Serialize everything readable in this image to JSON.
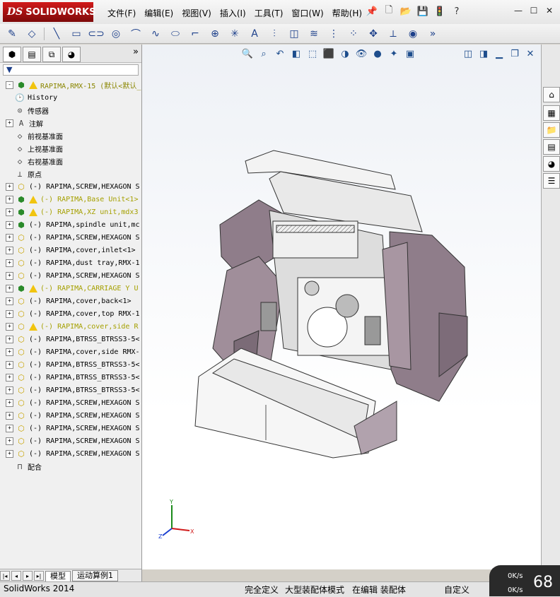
{
  "app": {
    "logo_ds": "DS",
    "logo_text": "SOLIDWORKS"
  },
  "menu": [
    {
      "label": "文件(F)"
    },
    {
      "label": "编辑(E)"
    },
    {
      "label": "视图(V)"
    },
    {
      "label": "插入(I)"
    },
    {
      "label": "工具(T)"
    },
    {
      "label": "窗口(W)"
    },
    {
      "label": "帮助(H)"
    }
  ],
  "panel_tabs": [
    "feature-manager",
    "property-manager",
    "configuration-manager",
    "display-manager"
  ],
  "tree": {
    "root": "RAPIMA,RMX-15  (默认<默认_",
    "items": [
      {
        "label": "History",
        "icon": "history-icon",
        "expand": false,
        "warn": false
      },
      {
        "label": "传感器",
        "icon": "sensor-icon",
        "expand": false,
        "warn": false
      },
      {
        "label": "注解",
        "icon": "annotation-icon",
        "expand": true,
        "warn": false
      },
      {
        "label": "前视基准面",
        "icon": "plane-icon",
        "expand": false,
        "warn": false
      },
      {
        "label": "上视基准面",
        "icon": "plane-icon",
        "expand": false,
        "warn": false
      },
      {
        "label": "右视基准面",
        "icon": "plane-icon",
        "expand": false,
        "warn": false
      },
      {
        "label": "原点",
        "icon": "origin-icon",
        "expand": false,
        "warn": false
      },
      {
        "label": "(-) RAPIMA,SCREW,HEXAGON S",
        "icon": "part-icon",
        "expand": true,
        "warn": false
      },
      {
        "label": "(-) RAPIMA,Base Unit<1>",
        "icon": "assembly-icon",
        "expand": true,
        "warn": true
      },
      {
        "label": "(-) RAPIMA,XZ unit,mdx3",
        "icon": "assembly-icon",
        "expand": true,
        "warn": true
      },
      {
        "label": "(-) RAPIMA,spindle unit,mc",
        "icon": "assembly-icon",
        "expand": true,
        "warn": false
      },
      {
        "label": "(-) RAPIMA,SCREW,HEXAGON S",
        "icon": "part-icon",
        "expand": true,
        "warn": false
      },
      {
        "label": "(-) RAPIMA,cover,inlet<1>",
        "icon": "part-icon",
        "expand": true,
        "warn": false
      },
      {
        "label": "(-) RAPIMA,dust tray,RMX-1",
        "icon": "part-icon",
        "expand": true,
        "warn": false
      },
      {
        "label": "(-) RAPIMA,SCREW,HEXAGON S",
        "icon": "part-icon",
        "expand": true,
        "warn": false
      },
      {
        "label": "(-) RAPIMA,CARRIAGE Y U",
        "icon": "assembly-icon",
        "expand": true,
        "warn": true
      },
      {
        "label": "(-) RAPIMA,cover,back<1>",
        "icon": "part-icon",
        "expand": true,
        "warn": false
      },
      {
        "label": "(-) RAPIMA,cover,top RMX-1",
        "icon": "part-icon",
        "expand": true,
        "warn": false
      },
      {
        "label": "(-) RAPIMA,cover,side R",
        "icon": "part-icon",
        "expand": true,
        "warn": true
      },
      {
        "label": "(-) RAPIMA,BTRSS_BTRSS3-5<",
        "icon": "part-icon",
        "expand": true,
        "warn": false
      },
      {
        "label": "(-) RAPIMA,cover,side RMX-",
        "icon": "part-icon",
        "expand": true,
        "warn": false
      },
      {
        "label": "(-) RAPIMA,BTRSS_BTRSS3-5<",
        "icon": "part-icon",
        "expand": true,
        "warn": false
      },
      {
        "label": "(-) RAPIMA,BTRSS_BTRSS3-5<",
        "icon": "part-icon",
        "expand": true,
        "warn": false
      },
      {
        "label": "(-) RAPIMA,BTRSS_BTRSS3-5<",
        "icon": "part-icon",
        "expand": true,
        "warn": false
      },
      {
        "label": "(-) RAPIMA,SCREW,HEXAGON S",
        "icon": "part-icon",
        "expand": true,
        "warn": false
      },
      {
        "label": "(-) RAPIMA,SCREW,HEXAGON S",
        "icon": "part-icon",
        "expand": true,
        "warn": false
      },
      {
        "label": "(-) RAPIMA,SCREW,HEXAGON S",
        "icon": "part-icon",
        "expand": true,
        "warn": false
      },
      {
        "label": "(-) RAPIMA,SCREW,HEXAGON S",
        "icon": "part-icon",
        "expand": true,
        "warn": false
      },
      {
        "label": "(-) RAPIMA,SCREW,HEXAGON S",
        "icon": "part-icon",
        "expand": true,
        "warn": false
      },
      {
        "label": "配合",
        "icon": "mate-icon",
        "expand": false,
        "warn": false
      }
    ]
  },
  "bottom_tabs": [
    "模型",
    "运动算例1"
  ],
  "triad": {
    "x": "X",
    "y": "Y",
    "z": "Z"
  },
  "status": {
    "app_version": "SolidWorks 2014",
    "fully_defined": "完全定义",
    "large_assembly": "大型装配体模式",
    "editing": "在编辑 装配体",
    "custom": "自定义"
  },
  "net_widget": {
    "up": "0K/s",
    "down": "0K/s",
    "percent": "68"
  },
  "colors": {
    "accent": "#c0171a",
    "warning": "#f1c40f",
    "model_purple": "#8f7d8a"
  }
}
